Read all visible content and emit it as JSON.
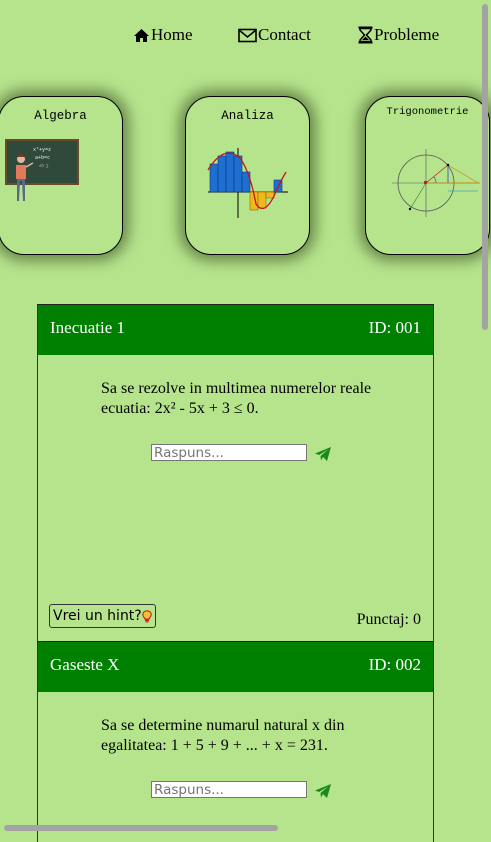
{
  "nav": {
    "home": "Home",
    "contact": "Contact",
    "probleme": "Probleme"
  },
  "categories": [
    {
      "title": "Algebra"
    },
    {
      "title": "Analiza"
    },
    {
      "title": "Trigonometrie"
    }
  ],
  "problems": [
    {
      "title": "Inecuatie 1",
      "id": "ID: 001",
      "statement_line1": "Sa se rezolve in multimea numerelor reale",
      "statement_line2": "ecuatia: 2x² - 5x + 3  ≤ 0.",
      "answer_placeholder": "Raspuns...",
      "hint_label": "Vrei un hint?",
      "score": "Punctaj: 0"
    },
    {
      "title": "Gaseste X",
      "id": "ID: 002",
      "statement_line1": "Sa se determine numarul natural x din",
      "statement_line2": "egalitatea: 1 + 5 + 9 + ... + x = 231.",
      "answer_placeholder": "Raspuns..."
    }
  ],
  "colors": {
    "background": "#b6e48c",
    "header": "#008000",
    "send_icon": "#1a8a1a"
  }
}
